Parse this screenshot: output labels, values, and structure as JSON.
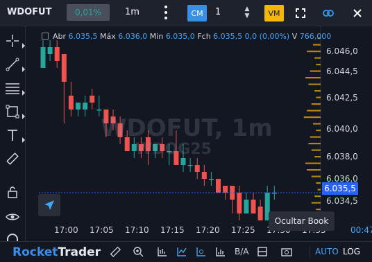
{
  "topbar": {
    "symbol": "WDOFUT",
    "change_pct": "0,01%",
    "interval": "1m",
    "cm_label": "CM",
    "quantity": "1",
    "vm_label": "VM"
  },
  "info": {
    "abr_label": "Abr",
    "abr_value": "6.035,5",
    "max_label": "Máx",
    "max_value": "6.036,0",
    "min_label": "Min",
    "min_value": "6.035,0",
    "fch_label": "Fch",
    "fch_value": "6.035,5",
    "change_value": "0,0 (0,00%)",
    "vol_label": "V",
    "vol_value": "766,000"
  },
  "watermark": {
    "line1": "WDOFUT, 1m",
    "line2": "WDOG25"
  },
  "axis": {
    "y_labels": [
      "6.046,0",
      "6.044,5",
      "6.042,5",
      "6.040,0",
      "6.038,0",
      "6.036,0",
      "6.034,5"
    ],
    "current_price": "6.035,5",
    "x_labels": [
      "17:00",
      "17:05",
      "17:10",
      "17:15",
      "17:20",
      "17:25",
      "17:30",
      "17:35"
    ],
    "timer": "00:47"
  },
  "tooltip": {
    "text": "Ocultar Book"
  },
  "bottombar": {
    "logo_part1": "Rocket",
    "logo_part2": "Trader",
    "ba_label": "B/A",
    "auto_label": "AUTO",
    "log_label": "LOG"
  },
  "colors": {
    "up": "#26a69a",
    "down": "#ef5350",
    "accent": "#2962ff",
    "vm": "#f5b800",
    "book": "#b8860b"
  },
  "chart_data": {
    "type": "candlestick",
    "symbol": "WDOFUT",
    "interval": "1m",
    "y_range": [
      6033.5,
      6046.5
    ],
    "y_ticks": [
      6046.0,
      6044.5,
      6042.5,
      6040.0,
      6038.0,
      6036.0,
      6034.5
    ],
    "x_ticks": [
      "17:00",
      "17:05",
      "17:10",
      "17:15",
      "17:20",
      "17:25",
      "17:30",
      "17:35"
    ],
    "current_price": 6035.5,
    "candles": [
      {
        "o": 6044.5,
        "h": 6046.5,
        "l": 6044.5,
        "c": 6046.0
      },
      {
        "o": 6045.5,
        "h": 6046.5,
        "l": 6045.0,
        "c": 6046.0
      },
      {
        "o": 6046.0,
        "h": 6046.5,
        "l": 6044.5,
        "c": 6045.0
      },
      {
        "o": 6045.5,
        "h": 6045.5,
        "l": 6040.5,
        "c": 6043.5
      },
      {
        "o": 6042.5,
        "h": 6043.5,
        "l": 6041.0,
        "c": 6041.5
      },
      {
        "o": 6041.5,
        "h": 6042.0,
        "l": 6041.0,
        "c": 6042.0
      },
      {
        "o": 6041.5,
        "h": 6042.5,
        "l": 6041.0,
        "c": 6042.0
      },
      {
        "o": 6042.5,
        "h": 6043.0,
        "l": 6041.5,
        "c": 6042.0
      },
      {
        "o": 6041.5,
        "h": 6042.5,
        "l": 6041.0,
        "c": 6041.5
      },
      {
        "o": 6041.5,
        "h": 6041.5,
        "l": 6039.5,
        "c": 6040.5
      },
      {
        "o": 6041.0,
        "h": 6041.5,
        "l": 6040.0,
        "c": 6040.5
      },
      {
        "o": 6040.5,
        "h": 6041.0,
        "l": 6039.0,
        "c": 6039.5
      },
      {
        "o": 6039.5,
        "h": 6040.0,
        "l": 6038.5,
        "c": 6038.5
      },
      {
        "o": 6038.5,
        "h": 6039.5,
        "l": 6038.0,
        "c": 6039.0
      },
      {
        "o": 6039.0,
        "h": 6039.5,
        "l": 6038.0,
        "c": 6038.5
      },
      {
        "o": 6039.5,
        "h": 6040.0,
        "l": 6037.5,
        "c": 6038.5
      },
      {
        "o": 6038.5,
        "h": 6039.0,
        "l": 6038.0,
        "c": 6039.0
      },
      {
        "o": 6039.0,
        "h": 6039.5,
        "l": 6038.0,
        "c": 6038.5
      },
      {
        "o": 6038.5,
        "h": 6039.0,
        "l": 6037.5,
        "c": 6038.5
      },
      {
        "o": 6038.5,
        "h": 6040.0,
        "l": 6037.5,
        "c": 6037.5
      },
      {
        "o": 6037.5,
        "h": 6039.0,
        "l": 6037.0,
        "c": 6038.0
      },
      {
        "o": 6037.5,
        "h": 6038.0,
        "l": 6037.0,
        "c": 6037.5
      },
      {
        "o": 6037.5,
        "h": 6038.0,
        "l": 6036.5,
        "c": 6037.0
      },
      {
        "o": 6037.0,
        "h": 6037.5,
        "l": 6036.0,
        "c": 6036.5
      },
      {
        "o": 6036.5,
        "h": 6037.0,
        "l": 6036.0,
        "c": 6036.5
      },
      {
        "o": 6036.5,
        "h": 6036.5,
        "l": 6035.5,
        "c": 6035.5
      },
      {
        "o": 6036.0,
        "h": 6036.0,
        "l": 6035.0,
        "c": 6035.5
      },
      {
        "o": 6036.0,
        "h": 6036.0,
        "l": 6034.0,
        "c": 6035.0
      },
      {
        "o": 6035.5,
        "h": 6036.0,
        "l": 6033.5,
        "c": 6034.0
      },
      {
        "o": 6034.0,
        "h": 6035.5,
        "l": 6034.0,
        "c": 6035.0
      },
      {
        "o": 6035.0,
        "h": 6035.5,
        "l": 6034.0,
        "c": 6034.0
      },
      {
        "o": 6034.5,
        "h": 6035.0,
        "l": 6033.5,
        "c": 6033.5
      },
      {
        "o": 6033.5,
        "h": 6036.0,
        "l": 6033.5,
        "c": 6035.5
      },
      {
        "o": 6035.5,
        "h": 6036.0,
        "l": 6035.0,
        "c": 6035.5
      }
    ],
    "book_volume": [
      2,
      5,
      9,
      4,
      3,
      7,
      10,
      8,
      4,
      3,
      6,
      9,
      11,
      5,
      3,
      7,
      8,
      6,
      4,
      10,
      9,
      6,
      3,
      2,
      4,
      6,
      3,
      2
    ]
  }
}
